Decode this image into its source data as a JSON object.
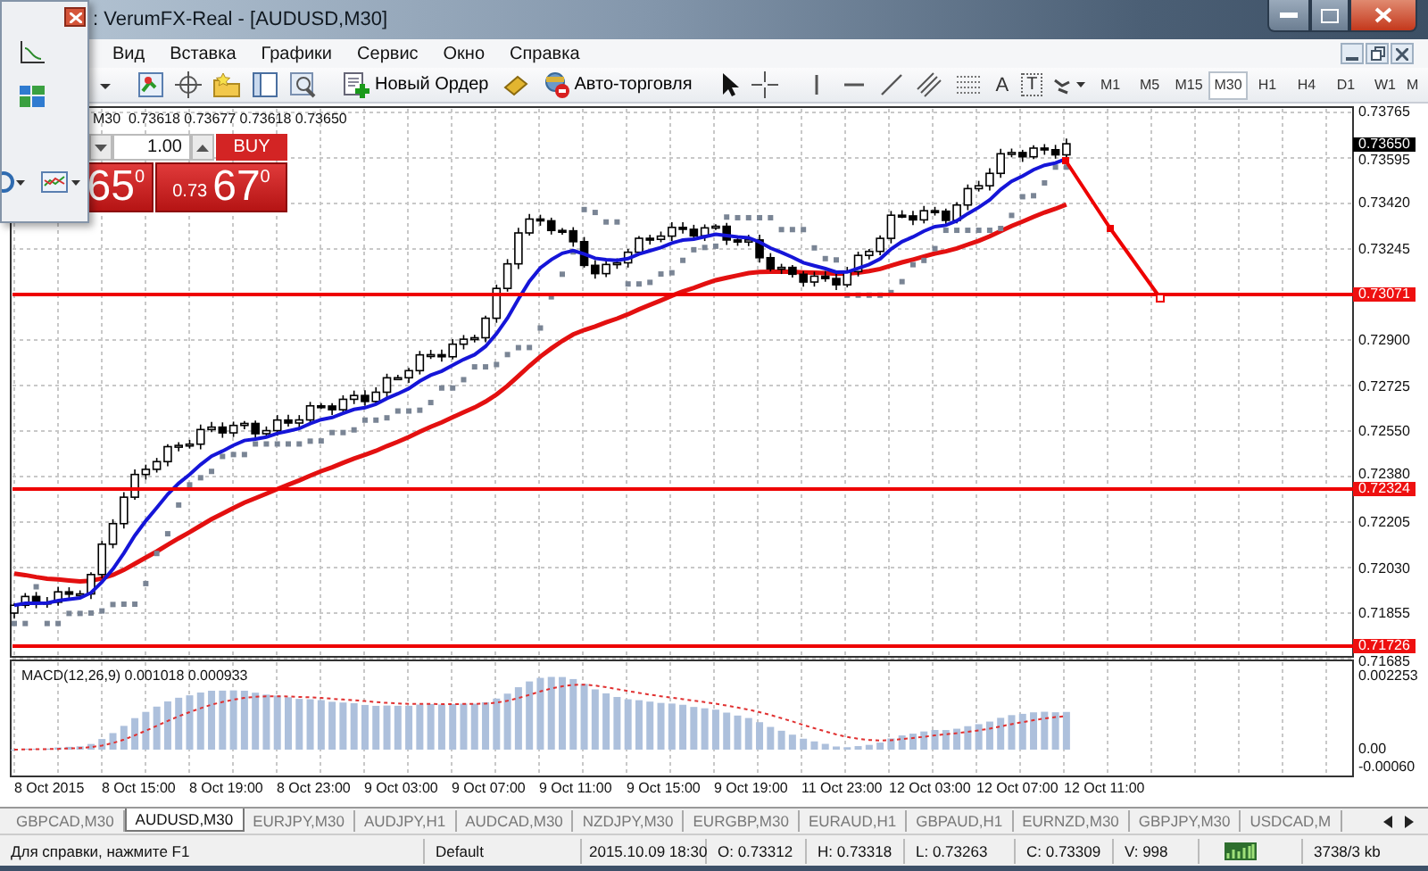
{
  "title_bar": {
    "title": ": VerumFX-Real - [AUDUSD,M30]"
  },
  "menu": [
    "Вид",
    "Вставка",
    "Графики",
    "Сервис",
    "Окно",
    "Справка"
  ],
  "toolbar": {
    "new_order": "Новый Ордер",
    "auto_trading": "Авто-торговля",
    "text_tool": "A",
    "text_label_tool": "T",
    "timeframes": [
      {
        "label": "M1",
        "selected": false
      },
      {
        "label": "M5",
        "selected": false
      },
      {
        "label": "M15",
        "selected": false
      },
      {
        "label": "M30",
        "selected": true
      },
      {
        "label": "H1",
        "selected": false
      },
      {
        "label": "H4",
        "selected": false
      },
      {
        "label": "D1",
        "selected": false
      },
      {
        "label": "W1",
        "selected": false
      },
      {
        "label": "M",
        "selected": false
      }
    ]
  },
  "chart": {
    "header": "M30  0.73618 0.73677 0.73618 0.73650",
    "trade_panel": {
      "lot": "1.00",
      "buy": "BUY",
      "sell_price": "65",
      "sell_point": "0",
      "buy_prefix": "0.73",
      "buy_price": "67",
      "buy_point": "0"
    },
    "price_labels": [
      "0.73765",
      "0.73595",
      "0.73420",
      "0.73245",
      "0.72900",
      "0.72725",
      "0.72550",
      "0.72380",
      "0.72205",
      "0.72030",
      "0.71855",
      "0.71685"
    ],
    "current_price": "0.73650",
    "levels": [
      "0.73071",
      "0.72324",
      "0.71726"
    ],
    "macd": {
      "label": "MACD(12,26,9) 0.001018 0.000933",
      "axis_labels": [
        "0.002253",
        "0.00",
        "-0.00060"
      ]
    },
    "time_labels": [
      "8 Oct 2015",
      "8 Oct 15:00",
      "8 Oct 19:00",
      "8 Oct 23:00",
      "9 Oct 03:00",
      "9 Oct 07:00",
      "9 Oct 11:00",
      "9 Oct 15:00",
      "9 Oct 19:00",
      "11 Oct 23:00",
      "12 Oct 03:00",
      "12 Oct 07:00",
      "12 Oct 11:00"
    ]
  },
  "tabs": [
    {
      "label": "GBPCAD,M30",
      "selected": false
    },
    {
      "label": "AUDUSD,M30",
      "selected": true
    },
    {
      "label": "EURJPY,M30",
      "selected": false
    },
    {
      "label": "AUDJPY,H1",
      "selected": false
    },
    {
      "label": "AUDCAD,M30",
      "selected": false
    },
    {
      "label": "NZDJPY,M30",
      "selected": false
    },
    {
      "label": "EURGBP,M30",
      "selected": false
    },
    {
      "label": "EURAUD,H1",
      "selected": false
    },
    {
      "label": "GBPAUD,H1",
      "selected": false
    },
    {
      "label": "EURNZD,M30",
      "selected": false
    },
    {
      "label": "GBPJPY,M30",
      "selected": false
    },
    {
      "label": "USDCAD,M",
      "selected": false
    }
  ],
  "status_bar": {
    "help": "Для справки, нажмите F1",
    "profile": "Default",
    "time": "2015.10.09 18:30",
    "open": "O: 0.73312",
    "high": "H: 0.73318",
    "low": "L: 0.73263",
    "close": "C: 0.73309",
    "volume": "V: 998",
    "traffic": "3738/3 kb"
  }
}
